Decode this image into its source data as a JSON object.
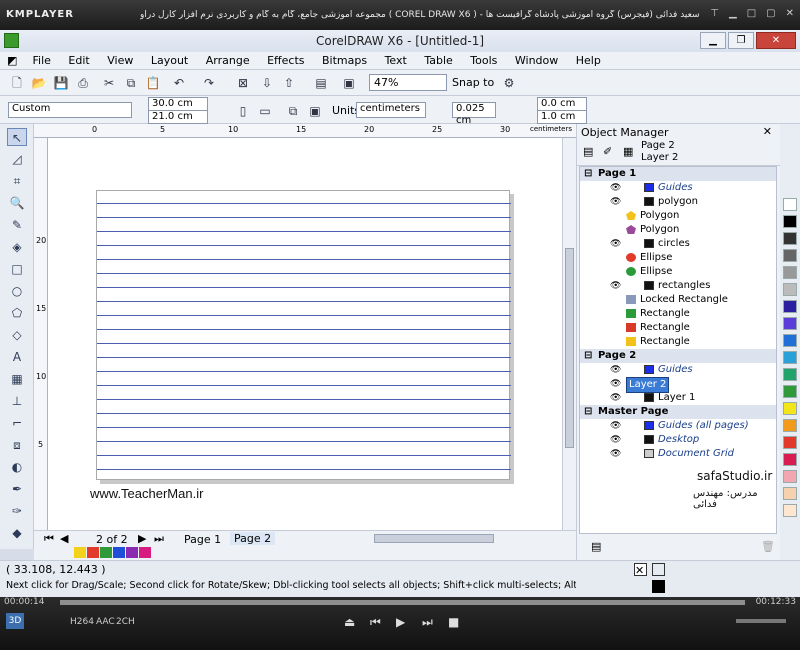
{
  "player": {
    "name": "KMPLAYER",
    "title": "مجموعه آموزشی جامع، گام به گام و کاربردی نرم افزار کارل دراو ( COREL DRAW X6 ) - مدرس : سعید فدائی (فیجرس) گروه آموزشی پادشاه گرافیست ها",
    "time_elapsed": "00:00:14",
    "time_total": "00:12:33",
    "badges": [
      "H264",
      "AAC",
      "2CH"
    ]
  },
  "app": {
    "title": "CorelDRAW X6 - [Untitled-1]"
  },
  "menu": [
    "File",
    "Edit",
    "View",
    "Layout",
    "Arrange",
    "Effects",
    "Bitmaps",
    "Text",
    "Table",
    "Tools",
    "Window",
    "Help"
  ],
  "toolbar": {
    "zoom": "47%",
    "snap": "Snap to"
  },
  "propbar": {
    "preset": "Custom",
    "width": "30.0 cm",
    "height": "21.0 cm",
    "units_label": "Units:",
    "units": "centimeters",
    "nudge": "0.025 cm",
    "dup_x": "0.0 cm",
    "dup_y": "1.0 cm"
  },
  "ruler": {
    "unit": "centimeters",
    "h_ticks": [
      "0",
      "5",
      "10",
      "15",
      "20",
      "25",
      "30"
    ],
    "v_ticks": [
      "20",
      "15",
      "10",
      "5"
    ]
  },
  "canvas": {
    "watermark": "www.TeacherMan.ir"
  },
  "pagebar": {
    "counter": "2 of 2",
    "tabs": [
      "Page 1",
      "Page 2"
    ]
  },
  "status": {
    "coords": "( 33.108, 12.443 )",
    "hint": "Next click for Drag/Scale; Second click for Rotate/Skew; Dbl-clicking tool selects all objects; Shift+click multi-selects; Alt+click digs"
  },
  "object_manager": {
    "title": "Object Manager",
    "current_page": "Page 2",
    "current_layer": "Layer 2",
    "rows": [
      {
        "label": "Page 1",
        "type": "section"
      },
      {
        "label": "Guides",
        "type": "layer",
        "italic": true,
        "color": "#1c2ee8"
      },
      {
        "label": "polygon",
        "type": "layer",
        "color": "#111111"
      },
      {
        "label": "Polygon",
        "type": "obj",
        "shape": "pentagon",
        "color": "#f2c21b"
      },
      {
        "label": "Polygon",
        "type": "obj",
        "shape": "pentagon",
        "color": "#9a4a9a"
      },
      {
        "label": "circles",
        "type": "layer",
        "color": "#111111"
      },
      {
        "label": "Ellipse",
        "type": "obj",
        "shape": "ellipse",
        "color": "#e23a2a"
      },
      {
        "label": "Ellipse",
        "type": "obj",
        "shape": "ellipse",
        "color": "#2a9a3a"
      },
      {
        "label": "rectangles",
        "type": "layer",
        "color": "#111111"
      },
      {
        "label": "Locked Rectangle",
        "type": "obj",
        "shape": "lock",
        "color": "#8899bb"
      },
      {
        "label": "Rectangle",
        "type": "obj",
        "shape": "rect",
        "color": "#2a9a3a"
      },
      {
        "label": "Rectangle",
        "type": "obj",
        "shape": "rect",
        "color": "#d83a2a"
      },
      {
        "label": "Rectangle",
        "type": "obj",
        "shape": "rect",
        "color": "#f2c21b"
      },
      {
        "label": "Page 2",
        "type": "section"
      },
      {
        "label": "Guides",
        "type": "layer",
        "italic": true,
        "color": "#1c2ee8"
      },
      {
        "label": "Layer 2",
        "type": "editing"
      },
      {
        "label": "Layer 1",
        "type": "layer",
        "color": "#111111"
      },
      {
        "label": "Master Page",
        "type": "section"
      },
      {
        "label": "Guides (all pages)",
        "type": "master",
        "color": "#1c2ee8"
      },
      {
        "label": "Desktop",
        "type": "master",
        "color": "#111111"
      },
      {
        "label": "Document Grid",
        "type": "master",
        "color": "#cccccc"
      }
    ]
  },
  "overlay": {
    "site": "safaStudio.ir",
    "teacher": "مدرس: مهندس فدائی"
  },
  "palette": {
    "side": [
      "#ffffff",
      "#000000",
      "#333333",
      "#666666",
      "#999999",
      "#bbbbbb",
      "#2c1fa0",
      "#5b3bd9",
      "#1f6fd6",
      "#2aa0d8",
      "#21a36b",
      "#2f9a3a",
      "#f2e61b",
      "#f29a1b",
      "#e23a2a",
      "#d81b50",
      "#f2a6b0",
      "#f5d1b0",
      "#ffe6d0"
    ],
    "bottom": [
      "#f2d21b",
      "#e23a2a",
      "#2f9a3a",
      "#1f4fd6",
      "#8a2ab0",
      "#d81b80"
    ]
  }
}
